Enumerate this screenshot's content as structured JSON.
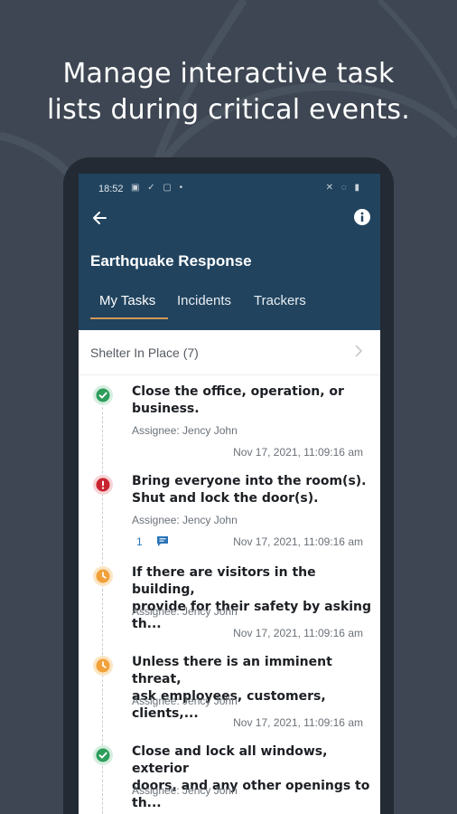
{
  "headline": {
    "line1": "Manage interactive task",
    "line2": "lists during critical events."
  },
  "status_bar": {
    "time": "18:52",
    "left_icons": "▣ ✓ ▢ •",
    "right_icons": "✕ ◌ ▮"
  },
  "app_bar": {
    "back_icon": "arrow-left-icon",
    "info_icon": "info-icon",
    "title": "Earthquake Response",
    "tabs": [
      {
        "label": "My Tasks",
        "active": true
      },
      {
        "label": "Incidents",
        "active": false
      },
      {
        "label": "Trackers",
        "active": false
      }
    ],
    "active_tab_color": "#d39656",
    "background": "#21435e"
  },
  "section": {
    "label": "Shelter In Place (7)"
  },
  "tasks": [
    {
      "status": "complete",
      "icon": "check-icon",
      "text": "Close the office, operation, or\nbusiness.",
      "assignee": "Assignee: Jency John",
      "timestamp": "Nov 17, 2021, 11:09:16 am"
    },
    {
      "status": "alert",
      "icon": "exclamation-icon",
      "text": "Bring everyone into the room(s).\nShut and lock the door(s).",
      "assignee": "Assignee: Jency John",
      "comment_count": "1",
      "timestamp": "Nov 17, 2021, 11:09:16 am"
    },
    {
      "status": "pending",
      "icon": "clock-icon",
      "text": "If there are visitors in the building,\nprovide for their safety by asking th...",
      "assignee": "Assignee: Jency John",
      "timestamp": "Nov 17, 2021, 11:09:16 am"
    },
    {
      "status": "pending",
      "icon": "clock-icon",
      "text": "Unless there is an imminent threat,\nask employees, customers, clients,...",
      "assignee": "Assignee: Jency John",
      "timestamp": "Nov 17, 2021, 11:09:16 am"
    },
    {
      "status": "complete",
      "icon": "check-icon",
      "text": "Close and lock all windows, exterior\ndoors, and any other openings to th...",
      "assignee": "Assignee: Jency John"
    }
  ],
  "colors": {
    "complete": "#2e9e5b",
    "alert": "#c8242f",
    "pending": "#f1a13a"
  }
}
